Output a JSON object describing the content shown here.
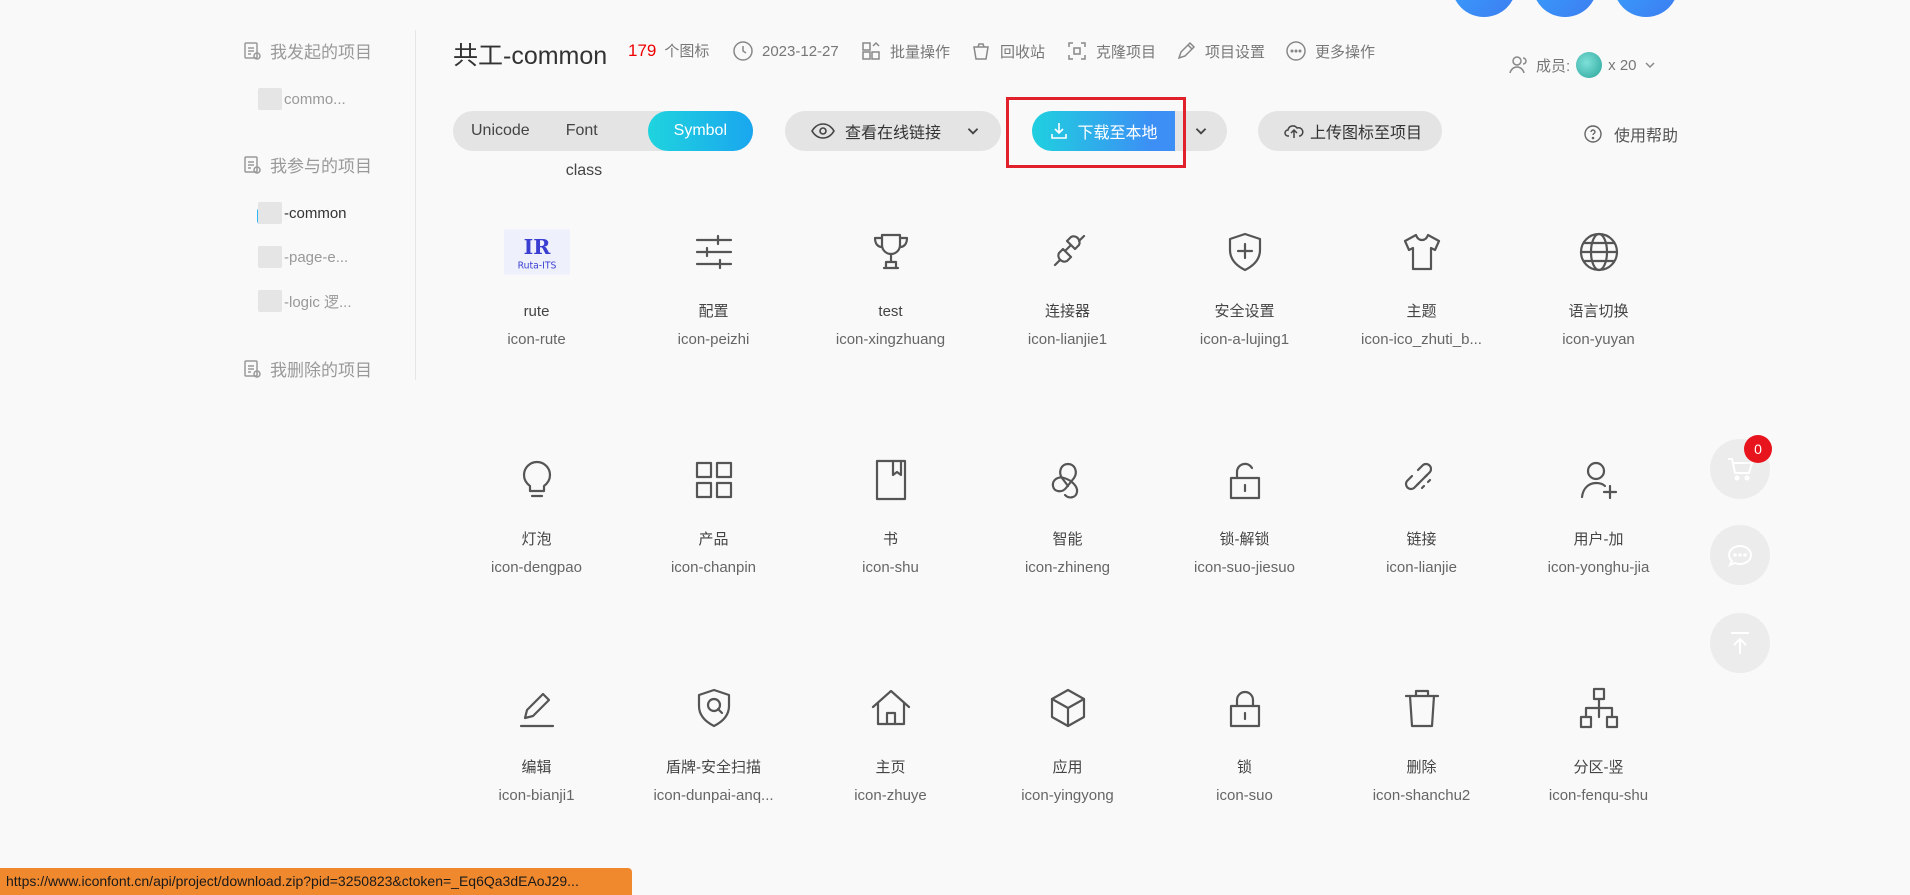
{
  "sidebar": {
    "group_started": "我发起的项目",
    "started_items": [
      "commo..."
    ],
    "group_joined": "我参与的项目",
    "joined_items": [
      "-common",
      "-page-e...",
      "-logic 逻..."
    ],
    "group_deleted": "我删除的项目"
  },
  "header": {
    "title": "共工-common",
    "icon_count": "179",
    "icon_count_unit": "个图标",
    "date": "2023-12-27",
    "batch": "批量操作",
    "recycle": "回收站",
    "clone": "克隆项目",
    "settings": "项目设置",
    "more": "更多操作",
    "members_label": "成员:",
    "members_count": "x 20"
  },
  "toolbar": {
    "tabs": [
      "Unicode",
      "Font class",
      "Symbol"
    ],
    "active_tab": "Symbol",
    "view_link": "查看在线链接",
    "download": "下载至本地",
    "upload": "上传图标至项目",
    "help": "使用帮助"
  },
  "icons": [
    {
      "name": "rute",
      "code": "icon-rute",
      "icon": "logo-icon"
    },
    {
      "name": "配置",
      "code": "icon-peizhi",
      "icon": "sliders-icon"
    },
    {
      "name": "test",
      "code": "icon-xingzhuang",
      "icon": "trophy-icon"
    },
    {
      "name": "连接器",
      "code": "icon-lianjie1",
      "icon": "plug-icon"
    },
    {
      "name": "安全设置",
      "code": "icon-a-lujing1",
      "icon": "shield-plus-icon"
    },
    {
      "name": "主题",
      "code": "icon-ico_zhuti_b...",
      "icon": "shirt-icon"
    },
    {
      "name": "语言切换",
      "code": "icon-yuyan",
      "icon": "globe-icon"
    },
    {
      "name": "灯泡",
      "code": "icon-dengpao",
      "icon": "bulb-icon"
    },
    {
      "name": "产品",
      "code": "icon-chanpin",
      "icon": "grid-icon"
    },
    {
      "name": "书",
      "code": "icon-shu",
      "icon": "book-icon"
    },
    {
      "name": "智能",
      "code": "icon-zhineng",
      "icon": "knot-icon"
    },
    {
      "name": "锁-解锁",
      "code": "icon-suo-jiesuo",
      "icon": "unlock-icon"
    },
    {
      "name": "链接",
      "code": "icon-lianjie",
      "icon": "link-icon"
    },
    {
      "name": "用户-加",
      "code": "icon-yonghu-jia",
      "icon": "user-plus-icon"
    },
    {
      "name": "编辑",
      "code": "icon-bianji1",
      "icon": "edit-icon"
    },
    {
      "name": "盾牌-安全扫描",
      "code": "icon-dunpai-anq...",
      "icon": "shield-scan-icon"
    },
    {
      "name": "主页",
      "code": "icon-zhuye",
      "icon": "home-icon"
    },
    {
      "name": "应用",
      "code": "icon-yingyong",
      "icon": "cube-icon"
    },
    {
      "name": "锁",
      "code": "icon-suo",
      "icon": "lock-icon"
    },
    {
      "name": "删除",
      "code": "icon-shanchu2",
      "icon": "trash-icon"
    },
    {
      "name": "分区-竖",
      "code": "icon-fenqu-shu",
      "icon": "hierarchy-icon"
    }
  ],
  "cart_badge": "0",
  "status_url": "https://www.iconfont.cn/api/project/download.zip?pid=3250823&ctoken=_Eq6Qa3dEAoJ29..."
}
